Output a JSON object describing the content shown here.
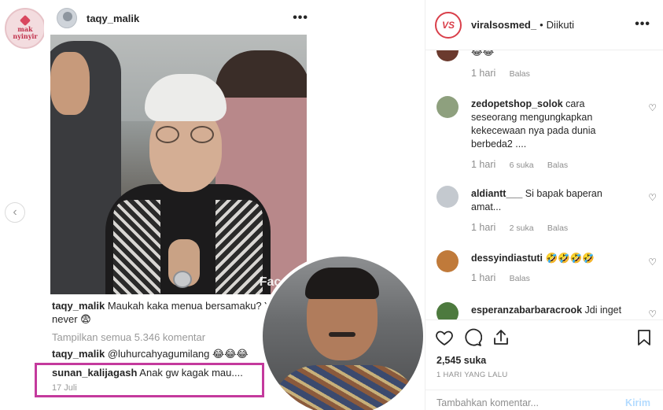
{
  "overlay_logo": {
    "line1": "mak",
    "line2": "nyinyir"
  },
  "inner_post": {
    "username": "taqy_malik",
    "more": "•••",
    "watermark": "FaceAr",
    "caption_user": "taqy_malik",
    "caption_text": "Maukah kaka menua bersamaku? Yes or never 😨",
    "view_all": "Tampilkan semua 5.346 komentar",
    "reply_user": "taqy_malik",
    "reply_mention": "@luhurcahyagumilang",
    "reply_emoji": "😂😂😂",
    "highlight_user": "sunan_kalijagash",
    "highlight_text": "Anak gw kagak mau....",
    "highlight_date": "17 Juli"
  },
  "nav": {
    "prev": "‹"
  },
  "sidebar": {
    "account": "viralsosmed_",
    "account_badge": "VS",
    "separator": "•",
    "follow_status": "Diikuti",
    "more": "•••",
    "comments": [
      {
        "user": "",
        "text": "😂😂",
        "time": "1 hari",
        "likes": "",
        "reply": "Balas",
        "avatar_color": "#6b3a2e"
      },
      {
        "user": "zedopetshop_solok",
        "text": "cara seseorang mengungkapkan kekecewaan nya pada dunia berbeda2 ....",
        "time": "1 hari",
        "likes": "6 suka",
        "reply": "Balas",
        "avatar_color": "#8ea07e"
      },
      {
        "user": "aldiantt___",
        "text": "Si bapak baperan amat...",
        "time": "1 hari",
        "likes": "2 suka",
        "reply": "Balas",
        "avatar_color": "#c4c9cf"
      },
      {
        "user": "dessyindiastuti",
        "text": "🤣🤣🤣🤣",
        "time": "1 hari",
        "likes": "",
        "reply": "Balas",
        "avatar_color": "#c07a3a"
      },
      {
        "user": "esperanzabarbaracrook",
        "text": "Jdi inget",
        "time": "",
        "likes": "",
        "reply": "",
        "avatar_color": "#4d7a3e"
      }
    ],
    "likes": "2,545 suka",
    "post_time": "1 HARI YANG LALU",
    "comment_placeholder": "Tambahkan komentar...",
    "send": "Kirim"
  },
  "colors": {
    "highlight_border": "#c43a9d",
    "accent_red": "#d93f4a",
    "muted": "#8e8e8e",
    "send_disabled": "#b3dbff"
  }
}
